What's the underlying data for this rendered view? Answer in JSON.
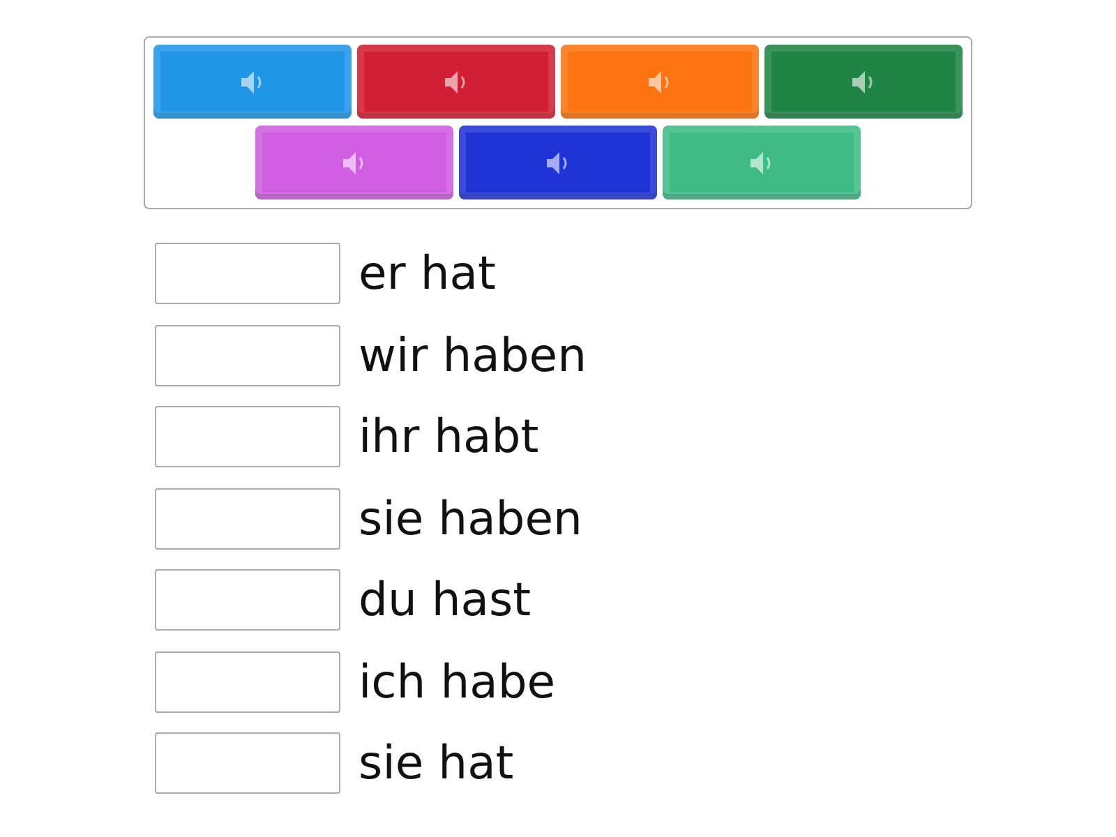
{
  "tiles": [
    {
      "color": "#2196e6"
    },
    {
      "color": "#d21f33"
    },
    {
      "color": "#fb7410"
    },
    {
      "color": "#1f8445"
    },
    {
      "color": "#cf5ee0"
    },
    {
      "color": "#2034d6"
    },
    {
      "color": "#3fbb86"
    }
  ],
  "items": [
    {
      "text": "er hat"
    },
    {
      "text": "wir haben"
    },
    {
      "text": "ihr habt"
    },
    {
      "text": "sie haben"
    },
    {
      "text": "du hast"
    },
    {
      "text": "ich habe"
    },
    {
      "text": "sie hat"
    }
  ]
}
